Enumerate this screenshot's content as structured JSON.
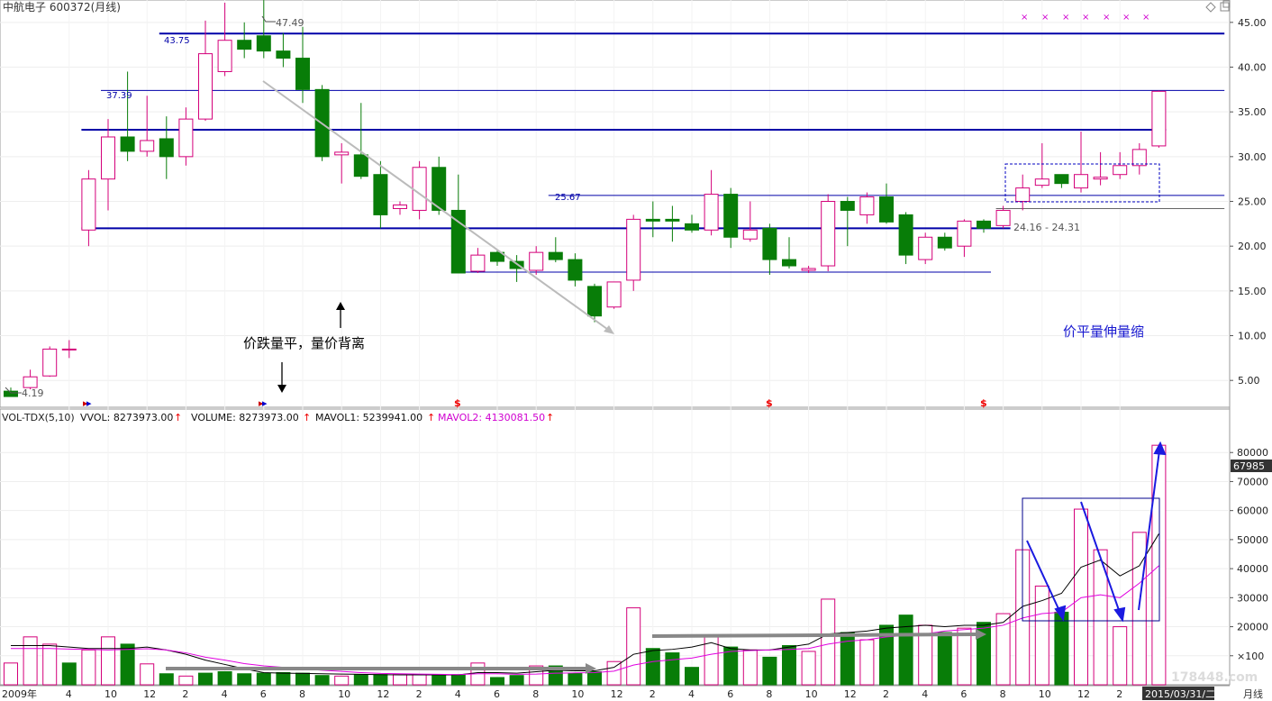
{
  "header": {
    "title": "中航电子 600372(月线)",
    "top_icons": [
      "diamond-icon",
      "restore-icon"
    ]
  },
  "indicator_bar": {
    "name": "VOL-TDX(5,10)",
    "vvol": "VVOL: 8273973.00",
    "volume": "VOLUME: 8273973.00",
    "mavol1": "MAVOL1: 5239941.00",
    "mavol2": "MAVOL2: 4130081.50"
  },
  "annotations": {
    "price_flat_note": "价跌量平，量价背离",
    "price_flat_vol_up": "价平量伸量缩",
    "range_label": "24.16 - 24.31",
    "low_label": "4.19",
    "high_label": "47.49",
    "level_4375": "43.75",
    "level_3739": "37.39",
    "level_2567": "25.67"
  },
  "footer": {
    "date_box": "2015/03/31/二",
    "period": "月线",
    "watermark": "178448.com"
  },
  "colors": {
    "up": "#d4007a",
    "down": "#087d08",
    "level": "#0000a8",
    "ma1": "#000000",
    "ma2": "#e000e0"
  },
  "chart_data": {
    "type": "candlestick",
    "title": "中航电子 600372(月线)",
    "price_axis": {
      "ylim": [
        2.0,
        47.5
      ],
      "ticks": [
        5,
        10,
        15,
        20,
        25,
        30,
        35,
        40,
        45
      ],
      "tick_labels": [
        "5.00",
        "10.00",
        "15.00",
        "20.00",
        "25.00",
        "30.00",
        "35.00",
        "40.00",
        "45.00"
      ]
    },
    "volume_axis": {
      "ylim": [
        0,
        90000
      ],
      "ticks": [
        10000,
        20000,
        30000,
        40000,
        50000,
        60000,
        70000,
        80000
      ],
      "tick_labels": [
        "×100",
        "20000",
        "30000",
        "40000",
        "50000",
        "60000",
        "70000",
        "80000"
      ],
      "current_label": "67985"
    },
    "x_tick_labels": [
      {
        "i": 0,
        "label": "2009年"
      },
      {
        "i": 3,
        "label": "4"
      },
      {
        "i": 5,
        "label": "10"
      },
      {
        "i": 7,
        "label": "12"
      },
      {
        "i": 9,
        "label": "2"
      },
      {
        "i": 11,
        "label": "4"
      },
      {
        "i": 13,
        "label": "6"
      },
      {
        "i": 15,
        "label": "8"
      },
      {
        "i": 17,
        "label": "10"
      },
      {
        "i": 19,
        "label": "12"
      },
      {
        "i": 21,
        "label": "2"
      },
      {
        "i": 23,
        "label": "4"
      },
      {
        "i": 25,
        "label": "6"
      },
      {
        "i": 27,
        "label": "8"
      },
      {
        "i": 29,
        "label": "10"
      },
      {
        "i": 31,
        "label": "12"
      },
      {
        "i": 33,
        "label": "2"
      },
      {
        "i": 35,
        "label": "4"
      },
      {
        "i": 37,
        "label": "6"
      },
      {
        "i": 39,
        "label": "8"
      },
      {
        "i": 41,
        "label": "10"
      },
      {
        "i": 43,
        "label": "12"
      },
      {
        "i": 45,
        "label": "2"
      },
      {
        "i": 47,
        "label": "4"
      },
      {
        "i": 49,
        "label": "6"
      },
      {
        "i": 51,
        "label": "8"
      },
      {
        "i": 53,
        "label": "10"
      },
      {
        "i": 55,
        "label": "12"
      },
      {
        "i": 57,
        "label": "2"
      }
    ],
    "candles": [
      {
        "o": 3.8,
        "h": 4.2,
        "l": 3.3,
        "c": 3.2
      },
      {
        "o": 4.2,
        "h": 6.2,
        "l": 4.0,
        "c": 5.4
      },
      {
        "o": 5.5,
        "h": 8.8,
        "l": 5.4,
        "c": 8.5
      },
      {
        "o": 8.5,
        "h": 9.5,
        "l": 7.5,
        "c": 8.5
      },
      {
        "o": 21.8,
        "h": 28.5,
        "l": 20.0,
        "c": 27.5
      },
      {
        "o": 27.5,
        "h": 34.2,
        "l": 24.0,
        "c": 32.2
      },
      {
        "o": 32.2,
        "h": 39.5,
        "l": 29.5,
        "c": 30.6
      },
      {
        "o": 30.6,
        "h": 36.8,
        "l": 30.0,
        "c": 31.8
      },
      {
        "o": 32.0,
        "h": 34.5,
        "l": 27.5,
        "c": 30.0
      },
      {
        "o": 30.0,
        "h": 35.5,
        "l": 29.0,
        "c": 34.2
      },
      {
        "o": 34.2,
        "h": 45.2,
        "l": 34.0,
        "c": 41.5
      },
      {
        "o": 39.5,
        "h": 47.2,
        "l": 39.0,
        "c": 43.0
      },
      {
        "o": 43.0,
        "h": 45.0,
        "l": 41.0,
        "c": 42.0
      },
      {
        "o": 43.5,
        "h": 47.5,
        "l": 41.0,
        "c": 41.8
      },
      {
        "o": 41.8,
        "h": 43.8,
        "l": 40.0,
        "c": 41.0
      },
      {
        "o": 41.0,
        "h": 44.5,
        "l": 36.0,
        "c": 37.5
      },
      {
        "o": 37.5,
        "h": 38.0,
        "l": 29.5,
        "c": 30.0
      },
      {
        "o": 30.2,
        "h": 31.5,
        "l": 27.0,
        "c": 30.5
      },
      {
        "o": 30.2,
        "h": 36.0,
        "l": 27.5,
        "c": 27.8
      },
      {
        "o": 28.0,
        "h": 29.5,
        "l": 22.0,
        "c": 23.5
      },
      {
        "o": 24.2,
        "h": 25.0,
        "l": 23.5,
        "c": 24.6
      },
      {
        "o": 24.0,
        "h": 29.5,
        "l": 23.0,
        "c": 28.8
      },
      {
        "o": 28.8,
        "h": 30.0,
        "l": 23.5,
        "c": 24.0
      },
      {
        "o": 24.0,
        "h": 28.0,
        "l": 17.0,
        "c": 17.0
      },
      {
        "o": 17.2,
        "h": 19.8,
        "l": 17.0,
        "c": 19.0
      },
      {
        "o": 19.3,
        "h": 19.5,
        "l": 17.8,
        "c": 18.3
      },
      {
        "o": 18.3,
        "h": 19.0,
        "l": 16.0,
        "c": 17.5
      },
      {
        "o": 17.3,
        "h": 20.0,
        "l": 16.8,
        "c": 19.3
      },
      {
        "o": 19.3,
        "h": 21.0,
        "l": 18.2,
        "c": 18.5
      },
      {
        "o": 18.5,
        "h": 19.2,
        "l": 15.5,
        "c": 16.2
      },
      {
        "o": 15.5,
        "h": 15.8,
        "l": 11.5,
        "c": 12.2
      },
      {
        "o": 13.2,
        "h": 16.0,
        "l": 13.0,
        "c": 16.0
      },
      {
        "o": 16.2,
        "h": 23.5,
        "l": 15.0,
        "c": 23.0
      },
      {
        "o": 23.0,
        "h": 25.0,
        "l": 21.0,
        "c": 22.8
      },
      {
        "o": 23.0,
        "h": 24.5,
        "l": 20.5,
        "c": 22.8
      },
      {
        "o": 22.5,
        "h": 23.5,
        "l": 21.5,
        "c": 21.8
      },
      {
        "o": 21.8,
        "h": 28.5,
        "l": 21.2,
        "c": 25.8
      },
      {
        "o": 25.8,
        "h": 26.5,
        "l": 19.8,
        "c": 21.0
      },
      {
        "o": 20.8,
        "h": 25.0,
        "l": 20.5,
        "c": 21.8
      },
      {
        "o": 22.0,
        "h": 22.5,
        "l": 16.8,
        "c": 18.5
      },
      {
        "o": 18.5,
        "h": 21.0,
        "l": 17.5,
        "c": 17.8
      },
      {
        "o": 17.3,
        "h": 17.8,
        "l": 17.0,
        "c": 17.5
      },
      {
        "o": 17.8,
        "h": 25.8,
        "l": 17.2,
        "c": 25.0
      },
      {
        "o": 25.0,
        "h": 25.5,
        "l": 20.0,
        "c": 24.0
      },
      {
        "o": 23.5,
        "h": 26.0,
        "l": 22.5,
        "c": 25.5
      },
      {
        "o": 25.5,
        "h": 27.0,
        "l": 22.5,
        "c": 22.7
      },
      {
        "o": 23.5,
        "h": 23.8,
        "l": 18.0,
        "c": 19.0
      },
      {
        "o": 18.5,
        "h": 21.5,
        "l": 18.0,
        "c": 21.0
      },
      {
        "o": 21.0,
        "h": 21.5,
        "l": 19.5,
        "c": 19.8
      },
      {
        "o": 20.0,
        "h": 23.0,
        "l": 18.8,
        "c": 22.8
      },
      {
        "o": 22.8,
        "h": 23.0,
        "l": 21.5,
        "c": 22.0
      },
      {
        "o": 22.3,
        "h": 24.5,
        "l": 22.0,
        "c": 24.0
      },
      {
        "o": 25.0,
        "h": 28.0,
        "l": 24.0,
        "c": 26.5
      },
      {
        "o": 26.8,
        "h": 31.5,
        "l": 26.5,
        "c": 27.5
      },
      {
        "o": 28.0,
        "h": 28.0,
        "l": 26.5,
        "c": 27.0
      },
      {
        "o": 26.5,
        "h": 32.8,
        "l": 26.0,
        "c": 28.0
      },
      {
        "o": 27.5,
        "h": 30.5,
        "l": 26.8,
        "c": 27.7
      },
      {
        "o": 28.0,
        "h": 30.5,
        "l": 27.5,
        "c": 29.0
      },
      {
        "o": 29.0,
        "h": 31.5,
        "l": 28.0,
        "c": 30.8
      },
      {
        "o": 31.2,
        "h": 37.4,
        "l": 31.0,
        "c": 37.3
      }
    ],
    "volume": [
      {
        "v": 7500,
        "up": true
      },
      {
        "v": 16500,
        "up": true
      },
      {
        "v": 14000,
        "up": true
      },
      {
        "v": 7500,
        "up": false
      },
      {
        "v": 12000,
        "up": true
      },
      {
        "v": 16500,
        "up": true
      },
      {
        "v": 14000,
        "up": false
      },
      {
        "v": 7200,
        "up": true
      },
      {
        "v": 3800,
        "up": false
      },
      {
        "v": 3000,
        "up": true
      },
      {
        "v": 4000,
        "up": false
      },
      {
        "v": 4500,
        "up": false
      },
      {
        "v": 3800,
        "up": false
      },
      {
        "v": 4000,
        "up": false
      },
      {
        "v": 4200,
        "up": false
      },
      {
        "v": 4000,
        "up": false
      },
      {
        "v": 3200,
        "up": false
      },
      {
        "v": 3000,
        "up": true
      },
      {
        "v": 3500,
        "up": false
      },
      {
        "v": 3500,
        "up": false
      },
      {
        "v": 3500,
        "up": true
      },
      {
        "v": 3500,
        "up": true
      },
      {
        "v": 3500,
        "up": false
      },
      {
        "v": 3500,
        "up": false
      },
      {
        "v": 7500,
        "up": true
      },
      {
        "v": 2500,
        "up": false
      },
      {
        "v": 3200,
        "up": false
      },
      {
        "v": 6500,
        "up": true
      },
      {
        "v": 6500,
        "up": false
      },
      {
        "v": 4000,
        "up": false
      },
      {
        "v": 4500,
        "up": false
      },
      {
        "v": 8000,
        "up": true
      },
      {
        "v": 26500,
        "up": true
      },
      {
        "v": 12500,
        "up": false
      },
      {
        "v": 11000,
        "up": false
      },
      {
        "v": 6000,
        "up": false
      },
      {
        "v": 16500,
        "up": true
      },
      {
        "v": 13000,
        "up": false
      },
      {
        "v": 12000,
        "up": true
      },
      {
        "v": 9500,
        "up": false
      },
      {
        "v": 13500,
        "up": false
      },
      {
        "v": 11500,
        "up": true
      },
      {
        "v": 29500,
        "up": true
      },
      {
        "v": 18000,
        "up": false
      },
      {
        "v": 15500,
        "up": true
      },
      {
        "v": 20500,
        "up": false
      },
      {
        "v": 24000,
        "up": false
      },
      {
        "v": 20500,
        "up": true
      },
      {
        "v": 18000,
        "up": false
      },
      {
        "v": 19500,
        "up": true
      },
      {
        "v": 21500,
        "up": false
      },
      {
        "v": 24500,
        "up": true
      },
      {
        "v": 46500,
        "up": true
      },
      {
        "v": 34000,
        "up": true
      },
      {
        "v": 25000,
        "up": false
      },
      {
        "v": 60500,
        "up": true
      },
      {
        "v": 46500,
        "up": true
      },
      {
        "v": 20000,
        "up": true
      },
      {
        "v": 52500,
        "up": true
      },
      {
        "v": 82500,
        "up": true
      }
    ],
    "mavol1": [
      13500,
      13500,
      13500,
      13000,
      12500,
      12500,
      12500,
      13000,
      12000,
      10500,
      8500,
      7000,
      5500,
      4200,
      4000,
      3900,
      3800,
      3700,
      3600,
      3500,
      3400,
      3400,
      3400,
      3400,
      4200,
      4200,
      4000,
      4500,
      5000,
      4800,
      4800,
      6000,
      10500,
      11800,
      12200,
      13000,
      14500,
      12500,
      12000,
      12000,
      13000,
      14000,
      17500,
      18000,
      18500,
      19500,
      20000,
      20500,
      20000,
      20500,
      20500,
      21500,
      27000,
      29000,
      31500,
      40500,
      43000,
      37500,
      41000,
      52000
    ],
    "mavol2": [
      12500,
      12500,
      12500,
      12300,
      12200,
      12000,
      12200,
      12400,
      12000,
      11000,
      9500,
      8500,
      7300,
      6500,
      6000,
      5500,
      5000,
      4600,
      4200,
      3900,
      3800,
      3700,
      3600,
      3500,
      3800,
      3800,
      3600,
      3700,
      4000,
      4100,
      4200,
      4700,
      6800,
      8000,
      8600,
      9200,
      10500,
      11500,
      11800,
      12000,
      12200,
      12500,
      14000,
      15000,
      15500,
      16500,
      17000,
      17500,
      18500,
      19000,
      19500,
      20500,
      23000,
      24500,
      25000,
      30000,
      31000,
      30000,
      35000,
      41000
    ],
    "levels": [
      {
        "v": 43.75,
        "from": 8,
        "to": 62,
        "width": 2,
        "label": "43.75"
      },
      {
        "v": 37.39,
        "from": 5,
        "to": 62,
        "width": 1,
        "label": "37.39"
      },
      {
        "v": 33.0,
        "from": 4,
        "to": 59,
        "width": 2
      },
      {
        "v": 25.67,
        "from": 28,
        "to": 62,
        "width": 1,
        "label": "25.67"
      },
      {
        "v": 24.2,
        "from": 51,
        "to": 62,
        "width": 1,
        "color": "#666"
      },
      {
        "v": 22.0,
        "from": 4,
        "to": 51,
        "width": 2
      },
      {
        "v": 17.1,
        "from": 23,
        "to": 50,
        "width": 1
      }
    ]
  }
}
